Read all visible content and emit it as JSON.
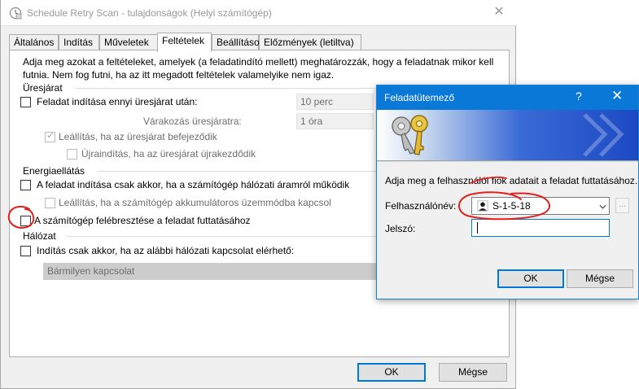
{
  "window": {
    "title": "Schedule Retry Scan - tulajdonságok (Helyi számítógép)",
    "close_symbol": "✕"
  },
  "tabs": [
    {
      "label": "Általános",
      "active": false
    },
    {
      "label": "Indítás",
      "active": false
    },
    {
      "label": "Műveletek",
      "active": false
    },
    {
      "label": "Feltételek",
      "active": true
    },
    {
      "label": "Beállítások",
      "active": false
    },
    {
      "label": "Előzmények (letiltva)",
      "active": false
    }
  ],
  "conditions": {
    "intro_line1": "Adja meg azokat a feltételeket, amelyek (a feladatindító mellett) meghatározzák, hogy a feladatnak mikor kell",
    "intro_line2": "futnia. Nem fog futni, ha az itt megadott feltételek valamelyike nem igaz.",
    "idle": {
      "group_label": "Üresjárat",
      "start_if_idle": {
        "label": "Feladat indítása ennyi üresjárat után:",
        "checked": false,
        "value": "10 perc"
      },
      "wait_label": "Várakozás üresjáratra:",
      "wait_value": "1 óra",
      "stop_if_not_idle": {
        "label": "Leállítás, ha az üresjárat befejeződik",
        "checked": true,
        "enabled": false
      },
      "restart_if_idle": {
        "label": "Újraindítás, ha az üresjárat újrakezdődik",
        "checked": false,
        "enabled": false
      }
    },
    "power": {
      "group_label": "Energiaellátás",
      "ac_only": {
        "label": "A feladat indítása csak akkor, ha a számítógép hálózati áramról működik",
        "checked": false
      },
      "stop_on_battery": {
        "label": "Leállítás, ha a számítógép akkumulátoros üzemmódba kapcsol",
        "checked": false,
        "enabled": false
      },
      "wake_to_run": {
        "label": "A számítógép felébresztése a feladat futtatásához",
        "checked": false
      }
    },
    "network": {
      "group_label": "Hálózat",
      "start_if_network": {
        "label": "Indítás csak akkor, ha az alábbi hálózati kapcsolat elérhető:",
        "checked": false
      },
      "connection_value": "Bármilyen kapcsolat"
    }
  },
  "main_buttons": {
    "ok": "OK",
    "cancel": "Mégse"
  },
  "dialog": {
    "title": "Feladatütemező",
    "help_symbol": "?",
    "close_symbol": "✕",
    "prompt": "Adja meg a felhasználói fiók adatait a feladat futtatásához.",
    "username_label": "Felhasználónév:",
    "username_value": "S-1-5-18",
    "browse_label": "...",
    "password_label": "Jelszó:",
    "password_value": "",
    "ok": "OK",
    "cancel": "Mégse"
  },
  "colors": {
    "accent": "#0078d7",
    "annotation": "#e0201b"
  }
}
